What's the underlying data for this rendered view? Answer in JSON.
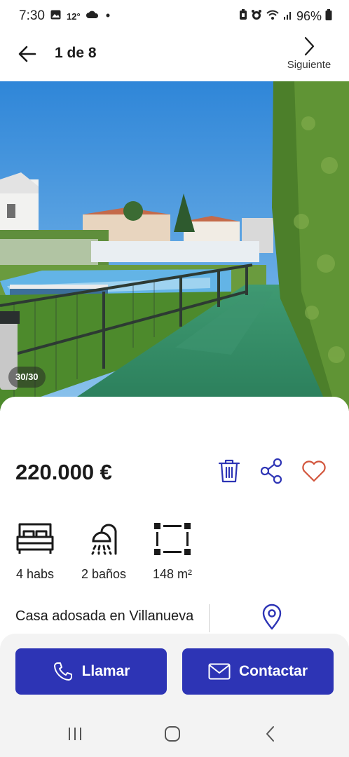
{
  "status_bar": {
    "time": "7:30",
    "temperature": "12°",
    "battery": "96%"
  },
  "header": {
    "counter": "1 de 8",
    "next_label": "Siguiente"
  },
  "photo": {
    "counter": "30/30"
  },
  "listing": {
    "price": "220.000 €",
    "features": [
      {
        "icon": "bed-icon",
        "label": "4 habs"
      },
      {
        "icon": "shower-icon",
        "label": "2 baños"
      },
      {
        "icon": "area-icon",
        "label": "148 m²"
      }
    ],
    "address": "Casa adosada en Villanueva"
  },
  "actions": {
    "call_label": "Llamar",
    "contact_label": "Contactar"
  },
  "colors": {
    "brand": "#2d34b5",
    "favorite": "#d2553c"
  }
}
